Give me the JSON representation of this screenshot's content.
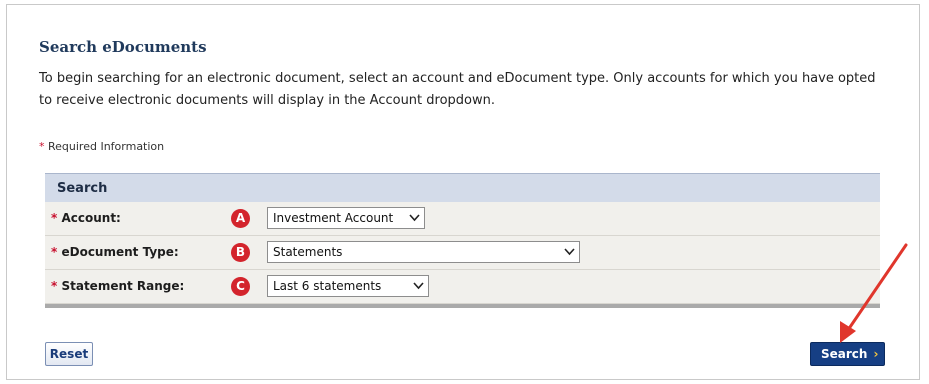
{
  "page": {
    "title": "Search eDocuments",
    "intro": "To begin searching for an electronic document, select an account and eDocument type. Only accounts for which you have opted to receive electronic documents will display in the Account dropdown.",
    "required_star": "*",
    "required_note": "Required Information"
  },
  "search_panel": {
    "heading": "Search",
    "rows": [
      {
        "label": "Account:",
        "badge": "A",
        "value": "Investment Account"
      },
      {
        "label": "eDocument Type:",
        "badge": "B",
        "value": "Statements"
      },
      {
        "label": "Statement Range:",
        "badge": "C",
        "value": "Last 6 statements"
      }
    ]
  },
  "buttons": {
    "reset_label": "Reset",
    "search_label": "Search"
  },
  "icons": {
    "dropdown": "chevron-down-icon",
    "search_chevron": "chevron-right-icon",
    "callout": "red-arrow-icon"
  },
  "colors": {
    "title": "#203a5c",
    "required_star": "#c8102e",
    "panel_header": "#d3dbe9",
    "badge": "#d3242c",
    "search_button": "#163f84",
    "arrow": "#e0362c"
  }
}
